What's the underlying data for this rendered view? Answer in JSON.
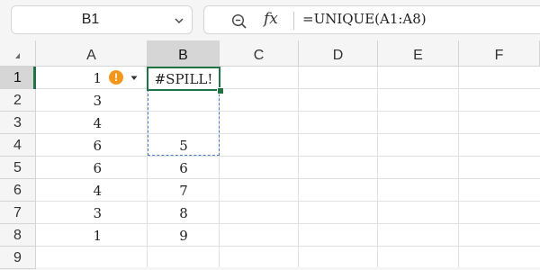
{
  "name_box": {
    "value": "B1"
  },
  "formula_bar": {
    "formula": "=UNIQUE(A1:A8)",
    "fx_label": "fx"
  },
  "columns": [
    "A",
    "B",
    "C",
    "D",
    "E",
    "F"
  ],
  "rows": [
    "1",
    "2",
    "3",
    "4",
    "5",
    "6",
    "7",
    "8",
    "9"
  ],
  "cells_A": [
    "1",
    "3",
    "4",
    "6",
    "6",
    "4",
    "3",
    "1"
  ],
  "cells_B": {
    "b1": "#SPILL!",
    "b4": "5",
    "b5": "6",
    "b6": "7",
    "b7": "8",
    "b8": "9"
  },
  "error_badge": {
    "symbol": "!"
  },
  "colors": {
    "selection": "#217346",
    "spill_border": "#4a78c4",
    "warning": "#f3961c"
  }
}
